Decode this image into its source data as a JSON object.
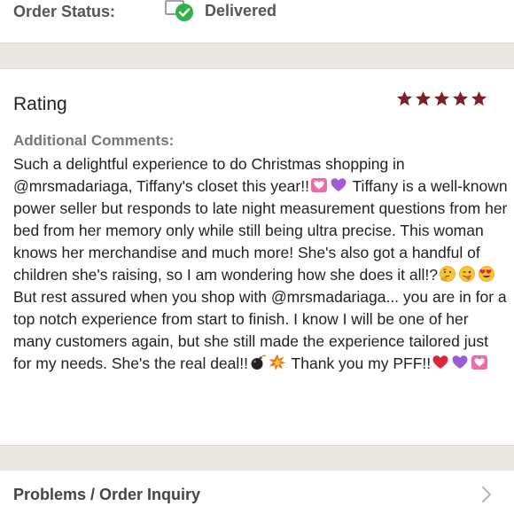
{
  "order_status": {
    "label": "Order Status:",
    "value": "Delivered",
    "icon": "delivered-box-check-icon"
  },
  "rating": {
    "title": "Rating",
    "stars": 5,
    "max_stars": 5,
    "star_color": "#7a1f2b"
  },
  "comments": {
    "label": "Additional Comments:",
    "segments": [
      {
        "type": "text",
        "text": "Such a delightful experience to do Christmas shopping in @mrsmadariaga, Tiffany's closet this year!!"
      },
      {
        "type": "emoji",
        "name": "heart-with-ribbon-emoji"
      },
      {
        "type": "emoji",
        "name": "purple-heart-emoji"
      },
      {
        "type": "text",
        "text": " Tiffany is a well-known power seller but responds to late night measurement questions from her bed from her memory only while still being ultra precise. This woman knows her merchandise and much more! She's also got a handful of children she's raising, so I am wondering how she does it all!?"
      },
      {
        "type": "emoji",
        "name": "thinking-face-emoji"
      },
      {
        "type": "emoji",
        "name": "winking-tongue-face-emoji"
      },
      {
        "type": "emoji",
        "name": "heart-eyes-face-emoji"
      },
      {
        "type": "text",
        "text": " But rest assured when you shop with @mrsmadariaga... you are in for a top notch experience from start to finish. I know I will be one of her many customers again, but she still made the experience tailored just for my needs. She's the real deal!!"
      },
      {
        "type": "emoji",
        "name": "bomb-emoji"
      },
      {
        "type": "emoji",
        "name": "collision-emoji"
      },
      {
        "type": "text",
        "text": " Thank you my PFF!!"
      },
      {
        "type": "emoji",
        "name": "red-heart-emoji"
      },
      {
        "type": "emoji",
        "name": "purple-heart-emoji"
      },
      {
        "type": "emoji",
        "name": "heart-with-ribbon-emoji"
      }
    ]
  },
  "problems": {
    "label": "Problems / Order Inquiry",
    "icon": "chevron-right-icon"
  },
  "colors": {
    "band": "#ebe8e3",
    "star": "#7a1f2b",
    "check_green": "#2fb24a"
  }
}
